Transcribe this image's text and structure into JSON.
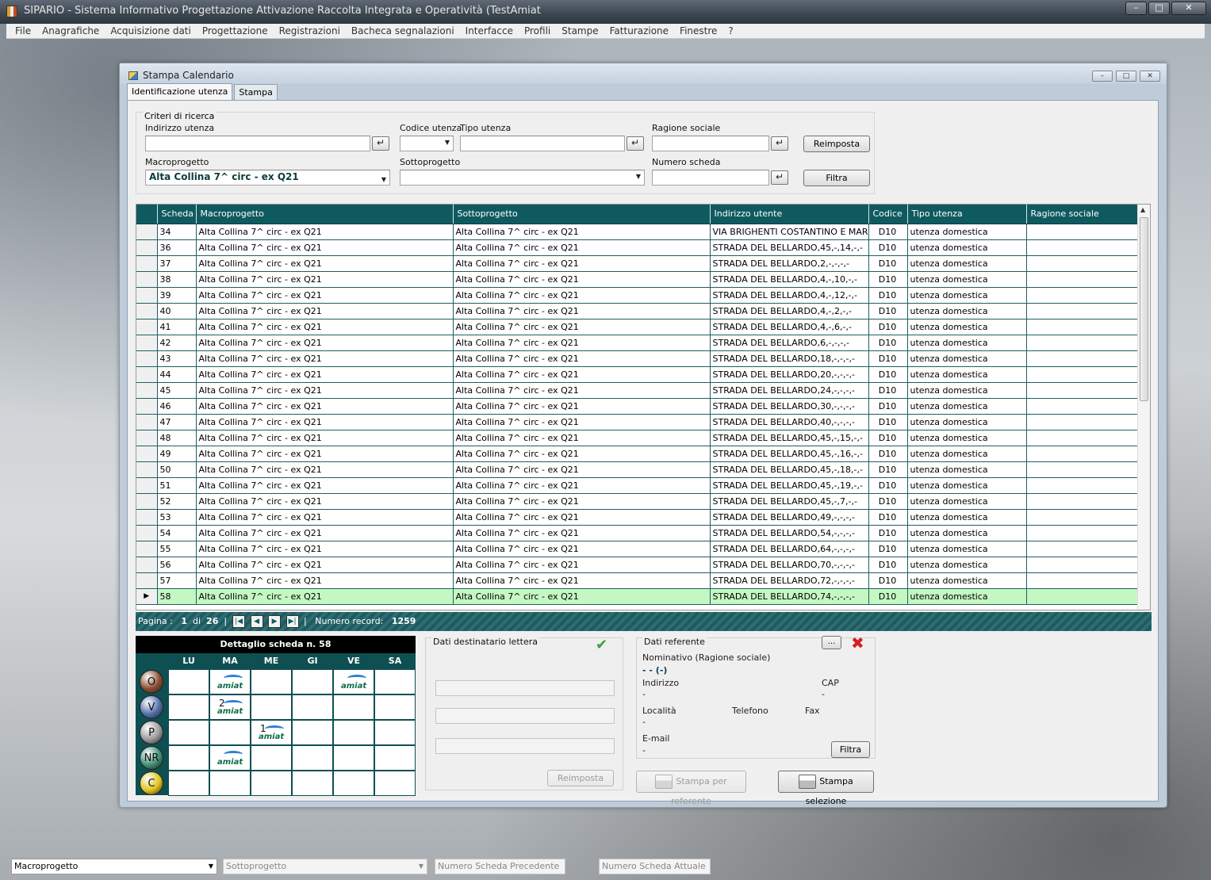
{
  "app": {
    "title": "SIPARIO - Sistema Informativo Progettazione Attivazione Raccolta Integrata e Operatività (TestAmiat",
    "win_min": "–",
    "win_max": "□",
    "win_close": "✕"
  },
  "menu": [
    "File",
    "Anagrafiche",
    "Acquisizione dati",
    "Progettazione",
    "Registrazioni",
    "Bacheca segnalazioni",
    "Interfacce",
    "Profili",
    "Stampe",
    "Fatturazione",
    "Finestre",
    "?"
  ],
  "child": {
    "title": "Stampa Calendario",
    "tabs": [
      "Identificazione utenza",
      "Stampa"
    ]
  },
  "search": {
    "group_title": "Criteri di ricerca",
    "indirizzo_label": "Indirizzo utenza",
    "codice_label": "Codice utenza",
    "tipo_label": "Tipo utenza",
    "ragione_label": "Ragione sociale",
    "macro_label": "Macroprogetto",
    "macro_value": "Alta Collina 7^ circ - ex Q21",
    "sotto_label": "Sottoprogetto",
    "numero_label": "Numero scheda",
    "reimposta": "Reimposta",
    "filtra": "Filtra",
    "enter_glyph": "↵"
  },
  "grid": {
    "columns": [
      "Scheda",
      "Macroprogetto",
      "Sottoprogetto",
      "Indirizzo utente",
      "Codice",
      "Tipo utenza",
      "Ragione sociale"
    ],
    "rows": [
      {
        "scheda": "34",
        "macro": "Alta Collina 7^ circ - ex Q21",
        "sotto": "Alta Collina 7^ circ - ex Q21",
        "indirizzo": "VIA BRIGHENTI COSTANTINO E MAR...",
        "codice": "D10",
        "tipo": "utenza domestica",
        "ragione": ""
      },
      {
        "scheda": "36",
        "macro": "Alta Collina 7^ circ - ex Q21",
        "sotto": "Alta Collina 7^ circ - ex Q21",
        "indirizzo": "STRADA DEL BELLARDO,45,-,14,-,-",
        "codice": "D10",
        "tipo": "utenza domestica",
        "ragione": ""
      },
      {
        "scheda": "37",
        "macro": "Alta Collina 7^ circ - ex Q21",
        "sotto": "Alta Collina 7^ circ - ex Q21",
        "indirizzo": "STRADA DEL BELLARDO,2,-,-,-,-",
        "codice": "D10",
        "tipo": "utenza domestica",
        "ragione": ""
      },
      {
        "scheda": "38",
        "macro": "Alta Collina 7^ circ - ex Q21",
        "sotto": "Alta Collina 7^ circ - ex Q21",
        "indirizzo": "STRADA DEL BELLARDO,4,-,10,-,-",
        "codice": "D10",
        "tipo": "utenza domestica",
        "ragione": ""
      },
      {
        "scheda": "39",
        "macro": "Alta Collina 7^ circ - ex Q21",
        "sotto": "Alta Collina 7^ circ - ex Q21",
        "indirizzo": "STRADA DEL BELLARDO,4,-,12,-,-",
        "codice": "D10",
        "tipo": "utenza domestica",
        "ragione": ""
      },
      {
        "scheda": "40",
        "macro": "Alta Collina 7^ circ - ex Q21",
        "sotto": "Alta Collina 7^ circ - ex Q21",
        "indirizzo": "STRADA DEL BELLARDO,4,-,2,-,-",
        "codice": "D10",
        "tipo": "utenza domestica",
        "ragione": ""
      },
      {
        "scheda": "41",
        "macro": "Alta Collina 7^ circ - ex Q21",
        "sotto": "Alta Collina 7^ circ - ex Q21",
        "indirizzo": "STRADA DEL BELLARDO,4,-,6,-,-",
        "codice": "D10",
        "tipo": "utenza domestica",
        "ragione": ""
      },
      {
        "scheda": "42",
        "macro": "Alta Collina 7^ circ - ex Q21",
        "sotto": "Alta Collina 7^ circ - ex Q21",
        "indirizzo": "STRADA DEL BELLARDO,6,-,-,-,-",
        "codice": "D10",
        "tipo": "utenza domestica",
        "ragione": ""
      },
      {
        "scheda": "43",
        "macro": "Alta Collina 7^ circ - ex Q21",
        "sotto": "Alta Collina 7^ circ - ex Q21",
        "indirizzo": "STRADA DEL BELLARDO,18,-,-,-,-",
        "codice": "D10",
        "tipo": "utenza domestica",
        "ragione": ""
      },
      {
        "scheda": "44",
        "macro": "Alta Collina 7^ circ - ex Q21",
        "sotto": "Alta Collina 7^ circ - ex Q21",
        "indirizzo": "STRADA DEL BELLARDO,20,-,-,-,-",
        "codice": "D10",
        "tipo": "utenza domestica",
        "ragione": ""
      },
      {
        "scheda": "45",
        "macro": "Alta Collina 7^ circ - ex Q21",
        "sotto": "Alta Collina 7^ circ - ex Q21",
        "indirizzo": "STRADA DEL BELLARDO,24,-,-,-,-",
        "codice": "D10",
        "tipo": "utenza domestica",
        "ragione": ""
      },
      {
        "scheda": "46",
        "macro": "Alta Collina 7^ circ - ex Q21",
        "sotto": "Alta Collina 7^ circ - ex Q21",
        "indirizzo": "STRADA DEL BELLARDO,30,-,-,-,-",
        "codice": "D10",
        "tipo": "utenza domestica",
        "ragione": ""
      },
      {
        "scheda": "47",
        "macro": "Alta Collina 7^ circ - ex Q21",
        "sotto": "Alta Collina 7^ circ - ex Q21",
        "indirizzo": "STRADA DEL BELLARDO,40,-,-,-,-",
        "codice": "D10",
        "tipo": "utenza domestica",
        "ragione": ""
      },
      {
        "scheda": "48",
        "macro": "Alta Collina 7^ circ - ex Q21",
        "sotto": "Alta Collina 7^ circ - ex Q21",
        "indirizzo": "STRADA DEL BELLARDO,45,-,15,-,-",
        "codice": "D10",
        "tipo": "utenza domestica",
        "ragione": ""
      },
      {
        "scheda": "49",
        "macro": "Alta Collina 7^ circ - ex Q21",
        "sotto": "Alta Collina 7^ circ - ex Q21",
        "indirizzo": "STRADA DEL BELLARDO,45,-,16,-,-",
        "codice": "D10",
        "tipo": "utenza domestica",
        "ragione": ""
      },
      {
        "scheda": "50",
        "macro": "Alta Collina 7^ circ - ex Q21",
        "sotto": "Alta Collina 7^ circ - ex Q21",
        "indirizzo": "STRADA DEL BELLARDO,45,-,18,-,-",
        "codice": "D10",
        "tipo": "utenza domestica",
        "ragione": ""
      },
      {
        "scheda": "51",
        "macro": "Alta Collina 7^ circ - ex Q21",
        "sotto": "Alta Collina 7^ circ - ex Q21",
        "indirizzo": "STRADA DEL BELLARDO,45,-,19,-,-",
        "codice": "D10",
        "tipo": "utenza domestica",
        "ragione": ""
      },
      {
        "scheda": "52",
        "macro": "Alta Collina 7^ circ - ex Q21",
        "sotto": "Alta Collina 7^ circ - ex Q21",
        "indirizzo": "STRADA DEL BELLARDO,45,-,7,-,-",
        "codice": "D10",
        "tipo": "utenza domestica",
        "ragione": ""
      },
      {
        "scheda": "53",
        "macro": "Alta Collina 7^ circ - ex Q21",
        "sotto": "Alta Collina 7^ circ - ex Q21",
        "indirizzo": "STRADA DEL BELLARDO,49,-,-,-,-",
        "codice": "D10",
        "tipo": "utenza domestica",
        "ragione": ""
      },
      {
        "scheda": "54",
        "macro": "Alta Collina 7^ circ - ex Q21",
        "sotto": "Alta Collina 7^ circ - ex Q21",
        "indirizzo": "STRADA DEL BELLARDO,54,-,-,-,-",
        "codice": "D10",
        "tipo": "utenza domestica",
        "ragione": ""
      },
      {
        "scheda": "55",
        "macro": "Alta Collina 7^ circ - ex Q21",
        "sotto": "Alta Collina 7^ circ - ex Q21",
        "indirizzo": "STRADA DEL BELLARDO,64,-,-,-,-",
        "codice": "D10",
        "tipo": "utenza domestica",
        "ragione": ""
      },
      {
        "scheda": "56",
        "macro": "Alta Collina 7^ circ - ex Q21",
        "sotto": "Alta Collina 7^ circ - ex Q21",
        "indirizzo": "STRADA DEL BELLARDO,70,-,-,-,-",
        "codice": "D10",
        "tipo": "utenza domestica",
        "ragione": ""
      },
      {
        "scheda": "57",
        "macro": "Alta Collina 7^ circ - ex Q21",
        "sotto": "Alta Collina 7^ circ - ex Q21",
        "indirizzo": "STRADA DEL BELLARDO,72,-,-,-,-",
        "codice": "D10",
        "tipo": "utenza domestica",
        "ragione": ""
      },
      {
        "scheda": "58",
        "macro": "Alta Collina 7^ circ - ex Q21",
        "sotto": "Alta Collina 7^ circ - ex Q21",
        "indirizzo": "STRADA DEL BELLARDO,74,-,-,-,-",
        "codice": "D10",
        "tipo": "utenza domestica",
        "ragione": "",
        "selected": true
      }
    ]
  },
  "pager": {
    "pagina_label": "Pagina :",
    "page": "1",
    "di_label": "di",
    "total": "26",
    "record_label": "Numero record:",
    "record_count": "1259",
    "first": "|◀",
    "prev": "◀",
    "next": "▶",
    "last": "▶|"
  },
  "calendar": {
    "title": "Dettaglio scheda n. 58",
    "days": [
      "LU",
      "MA",
      "ME",
      "GI",
      "VE",
      "SA"
    ],
    "rows": [
      {
        "label": "O",
        "color": "#8a4a2f"
      },
      {
        "label": "V",
        "color": "#4f6fa8"
      },
      {
        "label": "P",
        "color": "#9a9a9a"
      },
      {
        "label": "NR",
        "color": "#3f8f73"
      },
      {
        "label": "C",
        "color": "#e0c21c"
      }
    ],
    "marks": [
      {
        "row": 0,
        "col": 1,
        "num": ""
      },
      {
        "row": 0,
        "col": 4,
        "num": ""
      },
      {
        "row": 1,
        "col": 1,
        "num": "2"
      },
      {
        "row": 2,
        "col": 2,
        "num": "1"
      },
      {
        "row": 3,
        "col": 1,
        "num": ""
      }
    ],
    "logo_text": "amiat"
  },
  "destinatario": {
    "title": "Dati destinatario lettera",
    "reimposta": "Reimposta",
    "check_glyph": "✔"
  },
  "referente": {
    "title": "Dati referente",
    "more_btn": "...",
    "remove_glyph": "✖",
    "nominativo_label": "Nominativo (Ragione sociale)",
    "nominativo_value": "- - (-)",
    "indirizzo_label": "Indirizzo",
    "indirizzo_value": "-",
    "cap_label": "CAP",
    "cap_value": "-",
    "localita_label": "Località",
    "localita_value": "-",
    "telefono_label": "Telefono",
    "fax_label": "Fax",
    "email_label": "E-mail",
    "email_value": "-",
    "filtra": "Filtra"
  },
  "actions": {
    "stampa_referente": "Stampa per referente",
    "stampa_selezione": "Stampa selezione"
  },
  "statusbar": {
    "macro": "Macroprogetto",
    "sotto": "Sottoprogetto",
    "precedente": "Numero Scheda Precedente",
    "attuale": "Numero Scheda Attuale"
  }
}
